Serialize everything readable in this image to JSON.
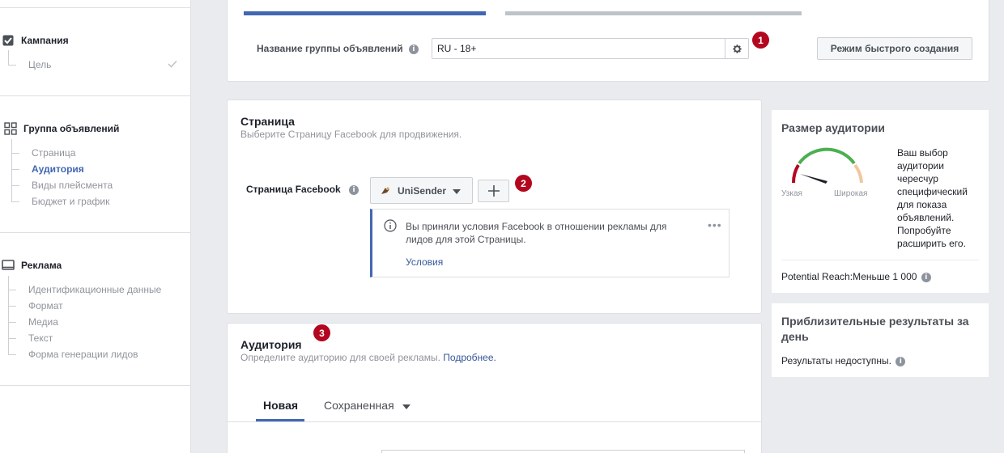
{
  "sidebar": {
    "campaign": {
      "label": "Кампания",
      "items": [
        "Цель"
      ]
    },
    "adset": {
      "label": "Группа объявлений",
      "items": [
        "Страница",
        "Аудитория",
        "Виды плейсмента",
        "Бюджет и график"
      ]
    },
    "ad": {
      "label": "Реклама",
      "items": [
        "Идентификационные данные",
        "Формат",
        "Медиа",
        "Текст",
        "Форма генерации лидов"
      ]
    }
  },
  "adset_name": {
    "label": "Название группы объявлений",
    "value": "RU - 18+",
    "badge": "1",
    "quick_mode_button": "Режим быстрого создания"
  },
  "page_section": {
    "title": "Страница",
    "subtitle": "Выберите Страницу Facebook для продвижения.",
    "field_label": "Страница Facebook",
    "selected_page": "UniSender",
    "badge": "2",
    "notice_text": "Вы приняли условия Facebook в отношении рекламы для лидов для этой Страницы.",
    "notice_link": "Условия"
  },
  "audience_section": {
    "title": "Аудитория",
    "badge": "3",
    "subtitle": "Определите аудиторию для своей рекламы.",
    "more_link": "Подробнее.",
    "tabs": [
      "Новая",
      "Сохраненная"
    ]
  },
  "audience_size": {
    "title": "Размер аудитории",
    "narrow_label": "Узкая",
    "wide_label": "Широкая",
    "description": "Ваш выбор аудитории чересчур специфический для показа объявлений. Попробуйте расширить его.",
    "reach_label": "Potential Reach:",
    "reach_value": "Меньше 1 000"
  },
  "daily_results": {
    "title": "Приблизительные результаты за день",
    "status": "Результаты недоступны."
  },
  "colors": {
    "accent": "#4267b2",
    "badge": "#b3071f",
    "gauge_green": "#4caf50",
    "gauge_red": "#b3071f",
    "gauge_peach": "#f0c8a0"
  }
}
